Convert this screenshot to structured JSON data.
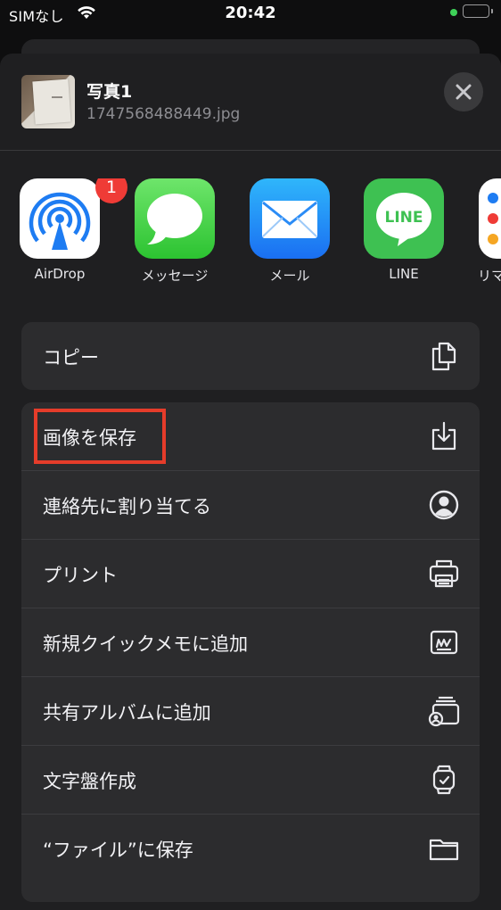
{
  "status_bar": {
    "carrier": "SIMなし",
    "time": "20:42"
  },
  "header": {
    "title": "写真1",
    "filename": "1747568488449.jpg"
  },
  "apps": [
    {
      "label": "AirDrop",
      "badge": "1"
    },
    {
      "label": "メッセージ"
    },
    {
      "label": "メール"
    },
    {
      "label": "LINE",
      "icon_text": "LINE"
    },
    {
      "label": "リマ"
    }
  ],
  "copy_action": {
    "label": "コピー"
  },
  "actions": [
    {
      "label": "画像を保存"
    },
    {
      "label": "連絡先に割り当てる"
    },
    {
      "label": "プリント"
    },
    {
      "label": "新規クイックメモに追加"
    },
    {
      "label": "共有アルバムに追加"
    },
    {
      "label": "文字盤作成"
    },
    {
      "label": "“ファイル”に保存"
    }
  ],
  "colors": {
    "sheet_bg": "#1f1f21",
    "row_bg": "#2c2c2e",
    "badge": "#ef3b36",
    "highlight": "#e53c2a",
    "battery_dot": "#3ed158"
  }
}
